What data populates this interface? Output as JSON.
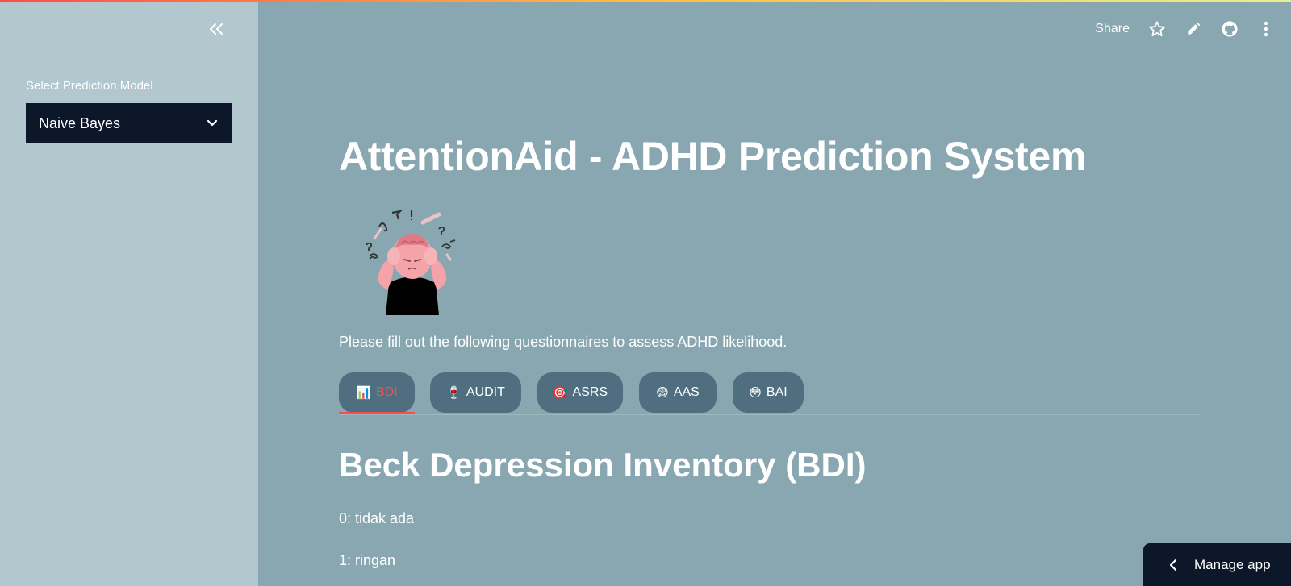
{
  "sidebar": {
    "label": "Select Prediction Model",
    "selected_model": "Naive Bayes"
  },
  "header": {
    "share_label": "Share"
  },
  "main": {
    "title": "AttentionAid - ADHD Prediction System",
    "intro": "Please fill out the following questionnaires to assess ADHD likelihood.",
    "tabs": [
      {
        "label": "BDI",
        "icon": "📊"
      },
      {
        "label": "AUDIT",
        "icon": "🍷"
      },
      {
        "label": "ASRS",
        "icon": "🎯"
      },
      {
        "label": "AAS",
        "icon": "😨"
      },
      {
        "label": "BAI",
        "icon": "😳"
      }
    ],
    "section_title": "Beck Depression Inventory (BDI)",
    "legend": [
      "0: tidak ada",
      "1: ringan"
    ]
  },
  "footer": {
    "manage_label": "Manage app"
  },
  "colors": {
    "accent": "#ff4b4b",
    "sidebar_bg": "#b3c7ce",
    "main_bg": "#89a7b0",
    "select_bg": "#0c1729",
    "tab_bg": "#4f6f80"
  }
}
